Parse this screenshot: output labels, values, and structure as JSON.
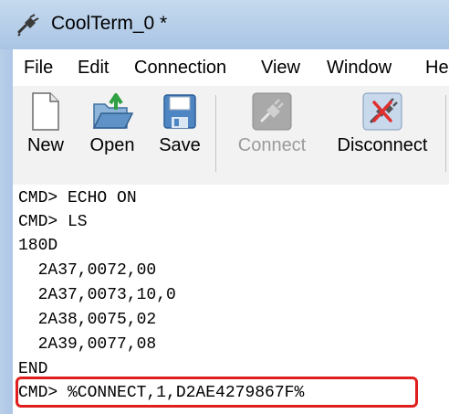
{
  "window": {
    "title": "CoolTerm_0 *"
  },
  "menu": [
    "File",
    "Edit",
    "Connection",
    "View",
    "Window",
    "He"
  ],
  "toolbar": {
    "new_label": "New",
    "open_label": "Open",
    "save_label": "Save",
    "connect_label": "Connect",
    "connect_state": "disabled",
    "disconnect_label": "Disconnect"
  },
  "terminal": {
    "lines": [
      "CMD> ECHO ON",
      "CMD> LS",
      "180D",
      "  2A37,0072,00",
      "  2A37,0073,10,0",
      "  2A38,0075,02",
      "  2A39,0077,08",
      "END",
      "CMD> %CONNECT,1,D2AE4279867F%"
    ],
    "highlighted_line": "CMD> %CONNECT,1,D2AE4279867F%"
  },
  "colors": {
    "highlight_border": "#e01e1e",
    "titlebar": "#b5cde8",
    "toolbar_bg": "#f2f2f2"
  },
  "icons": {
    "app": "coolterm-plug-icon",
    "new": "new-document-icon",
    "open": "open-folder-icon",
    "save": "floppy-disk-icon",
    "connect": "plug-connect-icon",
    "disconnect": "plug-disconnect-icon"
  }
}
